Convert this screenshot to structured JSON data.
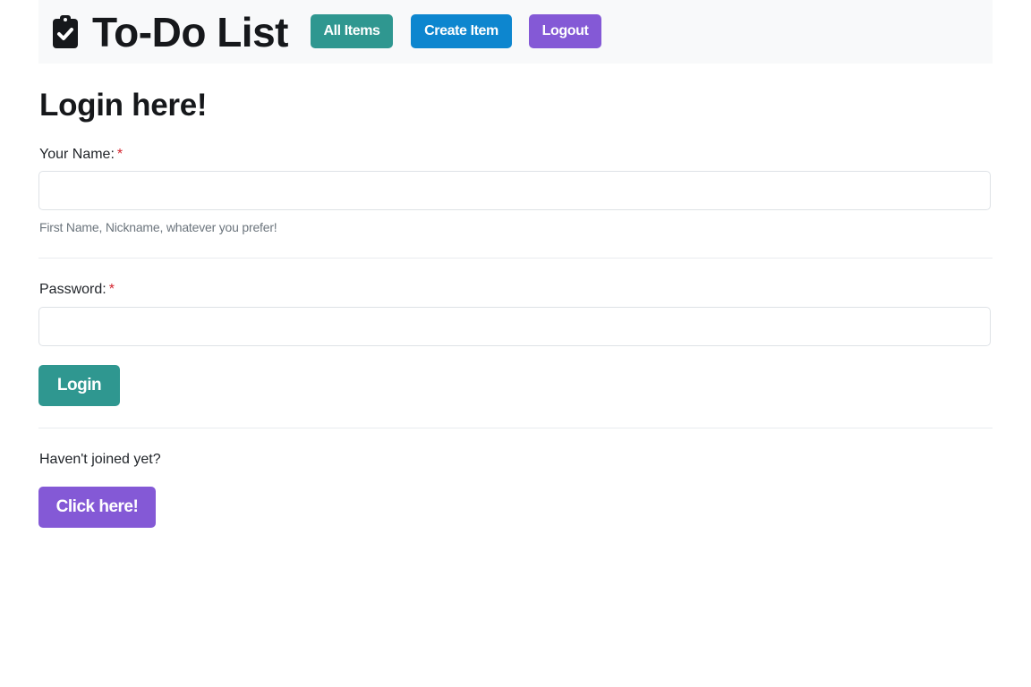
{
  "navbar": {
    "title": "To-Do List",
    "icon": "clipboard-check-icon",
    "buttons": {
      "all_items": "All Items",
      "create_item": "Create Item",
      "logout": "Logout"
    }
  },
  "form": {
    "heading": "Login here!",
    "name_label": "Your Name:",
    "name_required": "*",
    "name_value": "",
    "name_help": "First Name, Nickname, whatever you prefer!",
    "password_label": "Password:",
    "password_required": "*",
    "password_value": "",
    "login_button": "Login"
  },
  "signup": {
    "prompt": "Haven't joined yet?",
    "button": "Click here!"
  },
  "colors": {
    "teal": "#2f9790",
    "blue": "#0d86cf",
    "purple": "#8459d6",
    "required": "#d4252f"
  }
}
